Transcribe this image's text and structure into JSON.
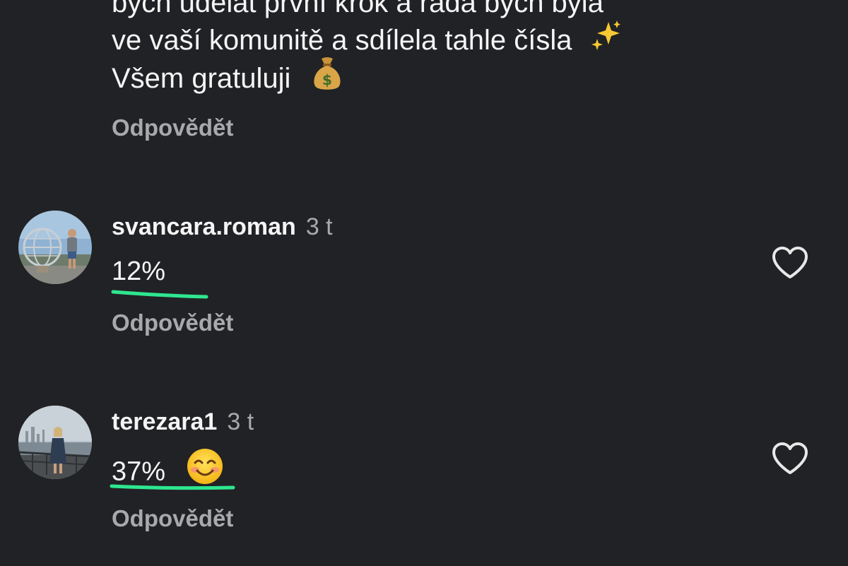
{
  "post_comment": {
    "line1": "bych udělat první krok a ráda bych byla",
    "line2": "ve vaší komunitě a sdílela tahle čísla",
    "line3": "Všem gratuluji",
    "reply_label": "Odpovědět"
  },
  "comments": [
    {
      "username": "svancara.roman",
      "time": "3 t",
      "text": "12%",
      "reply_label": "Odpovědět",
      "like_icon": "heart-outline-icon"
    },
    {
      "username": "terezara1",
      "time": "3 t",
      "text": "37%",
      "reply_label": "Odpovědět",
      "like_icon": "heart-outline-icon"
    }
  ],
  "colors": {
    "background": "#212226",
    "text": "#f5f5f5",
    "muted": "#a8a9ad",
    "highlight": "#2ee68f"
  }
}
